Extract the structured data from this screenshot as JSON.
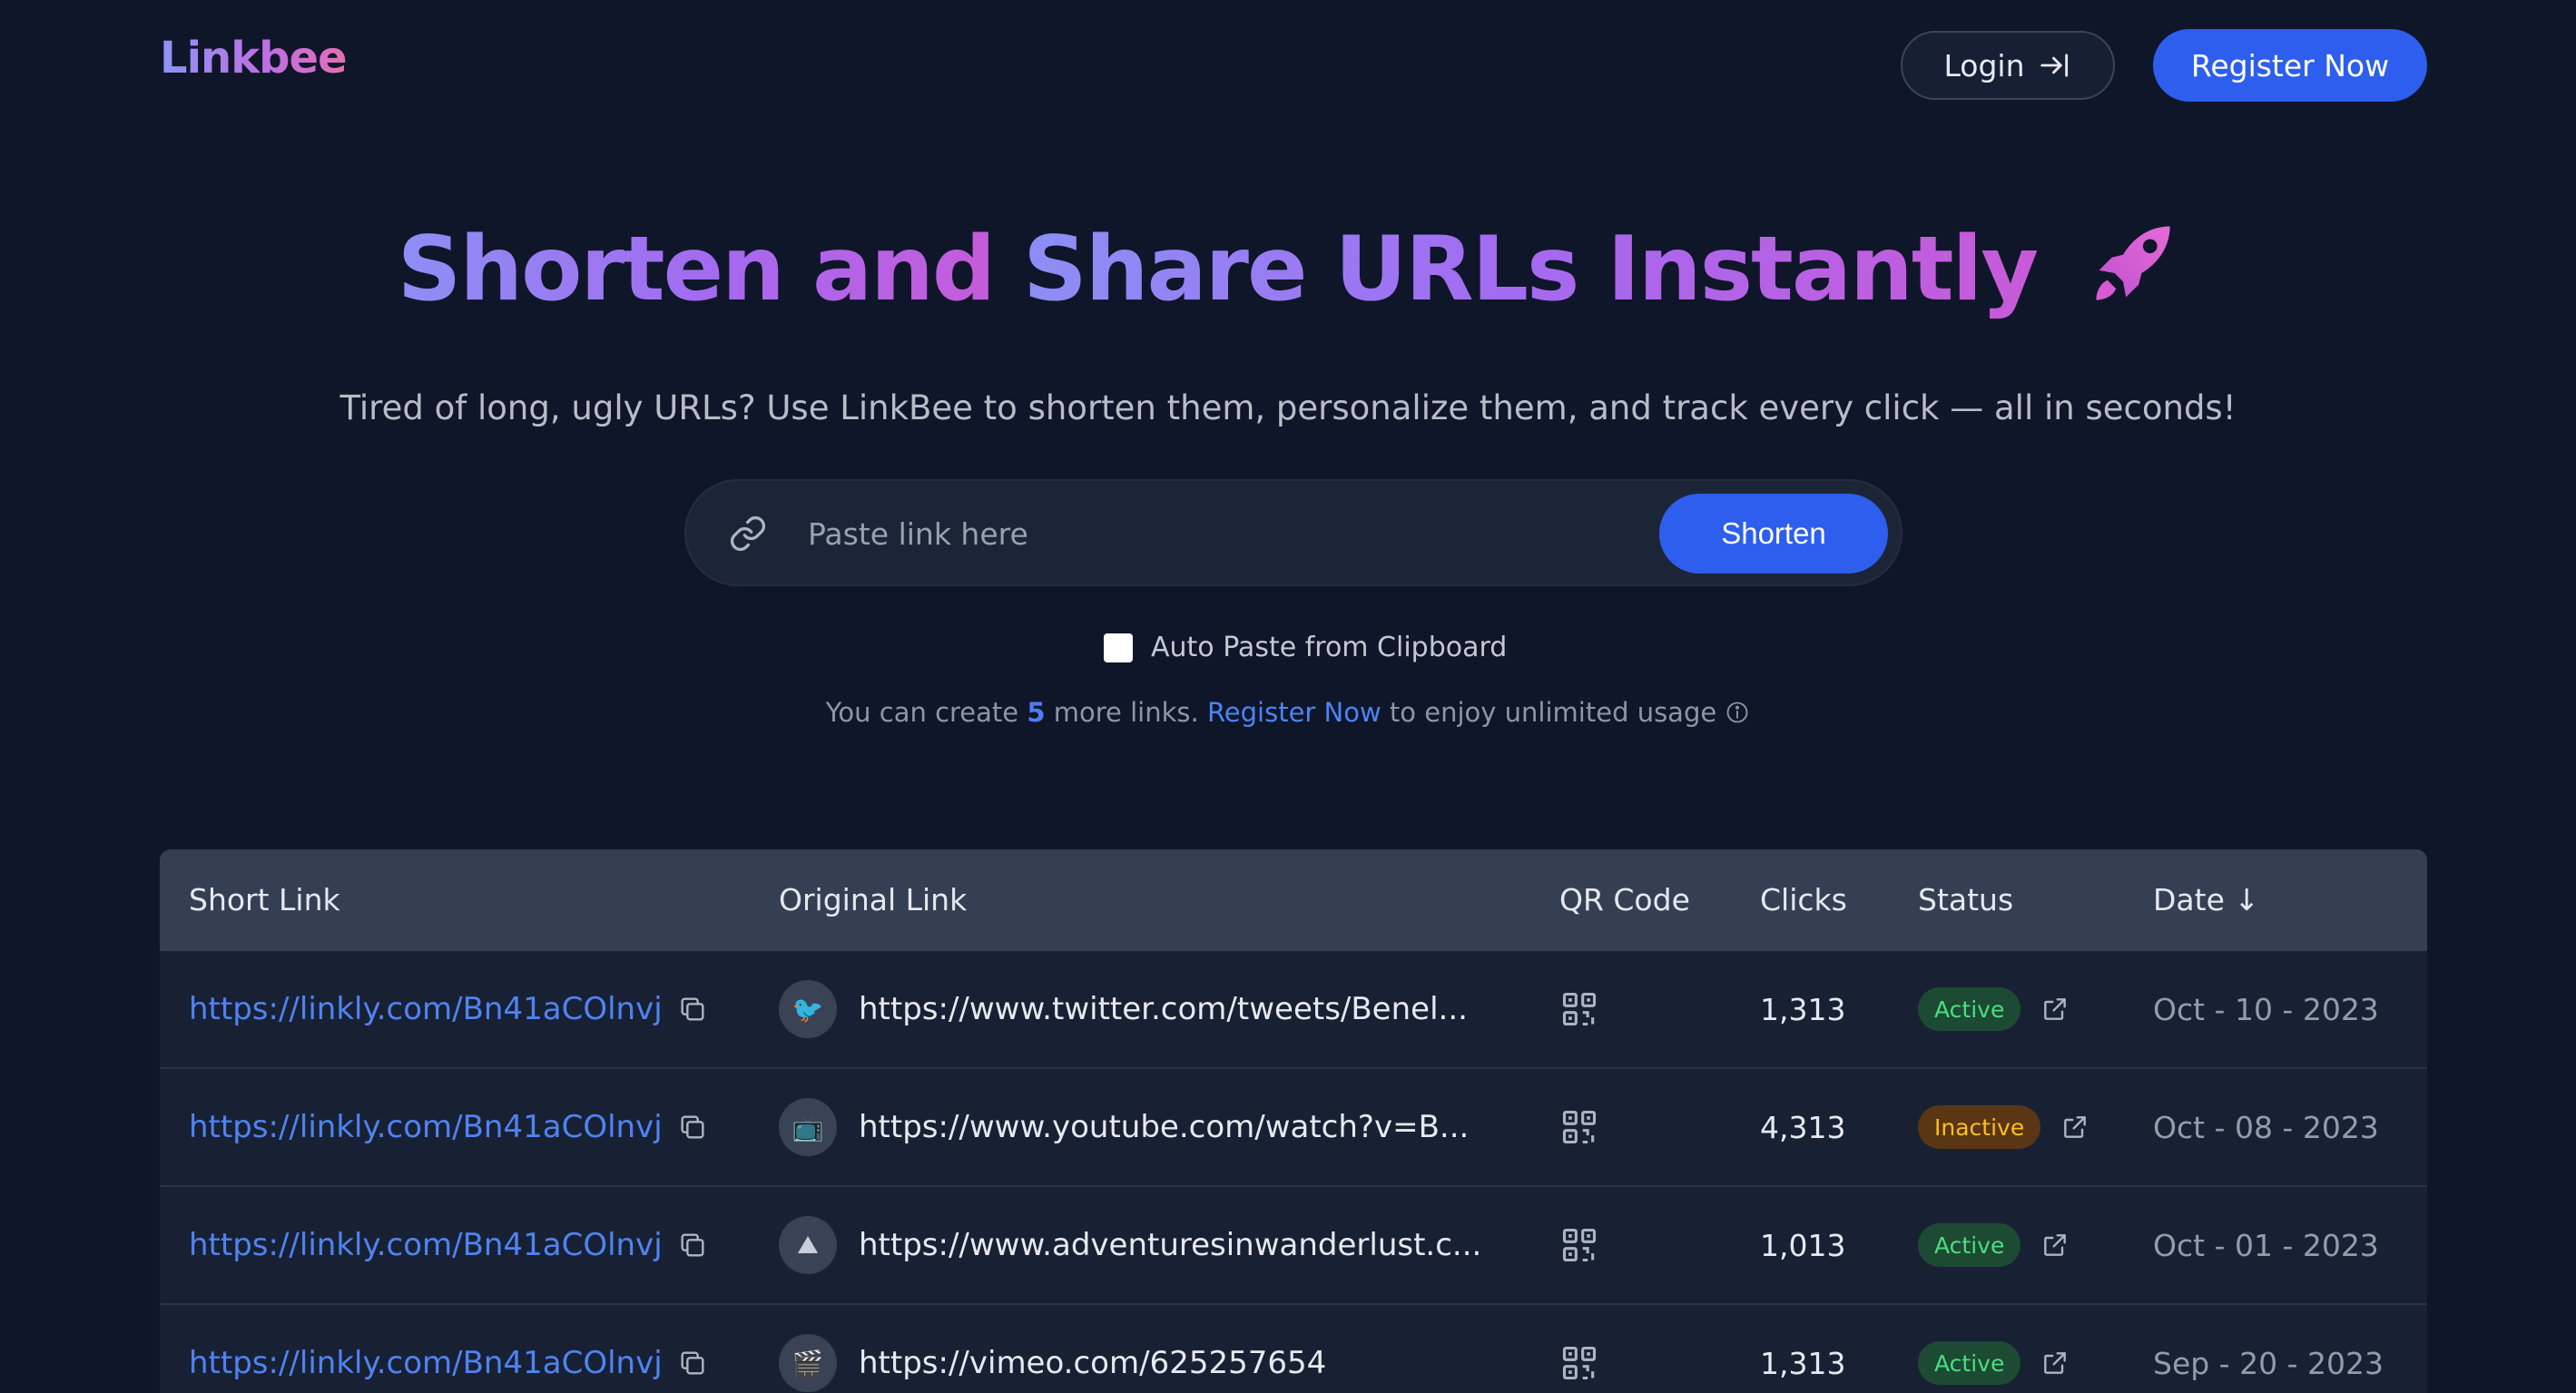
{
  "header": {
    "logo": "Linkbee",
    "login_label": "Login",
    "register_label": "Register Now"
  },
  "hero": {
    "title_part1": "Shorten and ",
    "title_part2": "Share URLs Instantly",
    "subtitle": "Tired of long, ugly URLs? Use LinkBee to shorten them, personalize them, and track every click — all in seconds!"
  },
  "search": {
    "placeholder": "Paste link here",
    "button_label": "Shorten"
  },
  "autopaste": {
    "label": "Auto Paste from Clipboard",
    "checked": false
  },
  "limit_note": {
    "prefix": "You can create ",
    "count": "5",
    "middle": " more links. ",
    "link": "Register Now",
    "suffix": " to enjoy unlimited usage"
  },
  "table": {
    "headers": {
      "short_link": "Short Link",
      "original_link": "Original Link",
      "qr_code": "QR Code",
      "clicks": "Clicks",
      "status": "Status",
      "date": "Date ↓"
    },
    "rows": [
      {
        "short": "https://linkly.com/Bn41aCOlnvj",
        "icon": "twitter-icon",
        "glyph": "🐦",
        "original": "https://www.twitter.com/tweets/Benel...",
        "clicks": "1,313",
        "status": "Active",
        "date": "Oct - 10 - 2023"
      },
      {
        "short": "https://linkly.com/Bn41aCOlnvj",
        "icon": "youtube-icon",
        "glyph": "📺",
        "original": "https://www.youtube.com/watch?v=B...",
        "clicks": "4,313",
        "status": "Inactive",
        "date": "Oct - 08 - 2023"
      },
      {
        "short": "https://linkly.com/Bn41aCOlnvj",
        "icon": "mountain-icon",
        "glyph": "⛰",
        "original": "https://www.adventuresinwanderlust.c...",
        "clicks": "1,013",
        "status": "Active",
        "date": "Oct - 01 - 2023"
      },
      {
        "short": "https://linkly.com/Bn41aCOlnvj",
        "icon": "vimeo-icon",
        "glyph": "🎬",
        "original": "https://vimeo.com/625257654",
        "clicks": "1,313",
        "status": "Active",
        "date": "Sep - 20 - 2023"
      }
    ]
  }
}
